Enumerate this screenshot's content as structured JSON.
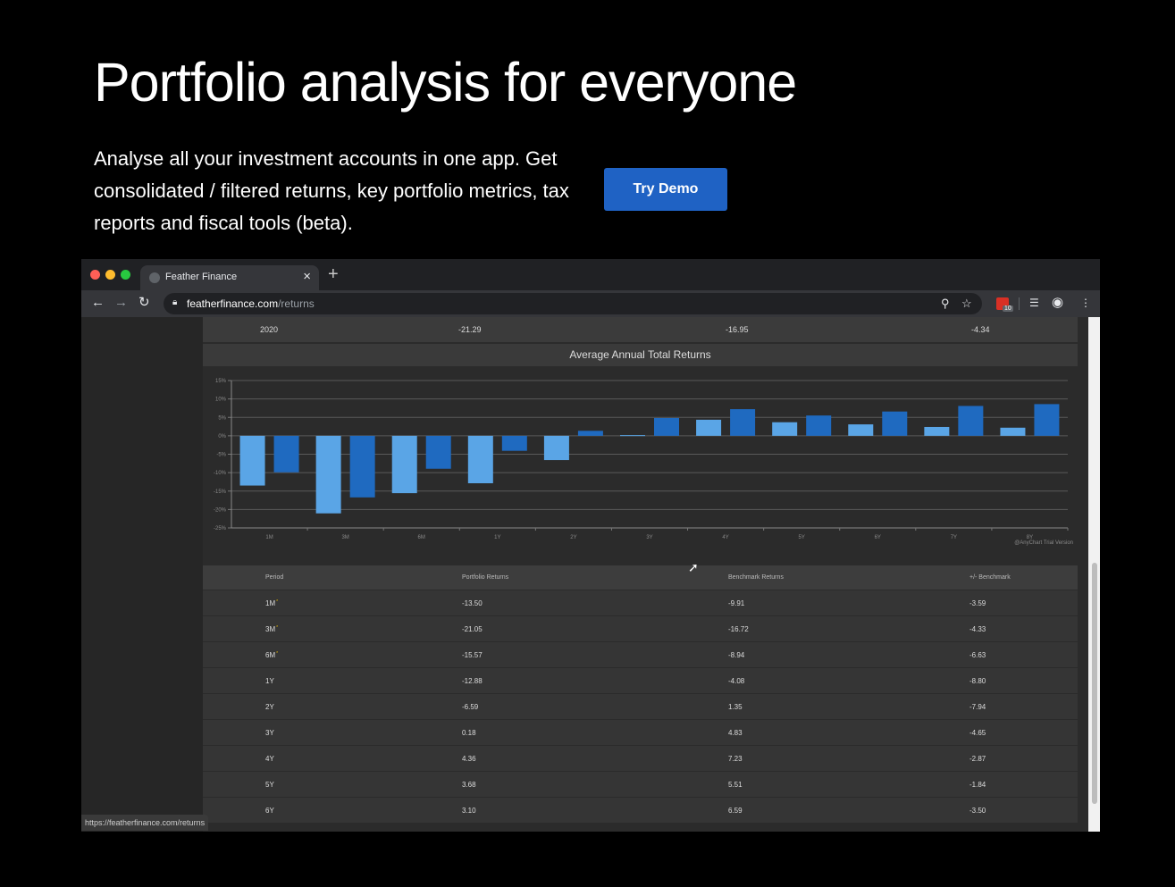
{
  "hero": {
    "title": "Portfolio analysis for everyone",
    "description": "Analyse all your investment accounts in one app. Get consolidated / filtered returns, key portfolio metrics, tax reports and fiscal tools (beta).",
    "cta_label": "Try Demo"
  },
  "browser": {
    "tab_title": "Feather Finance",
    "tab_close": "×",
    "new_tab": "+",
    "url_host": "featherfinance.com",
    "url_path": "/returns",
    "extension_badge": "10",
    "status_url": "https://featherfinance.com/returns",
    "colors": {
      "red": "#ff5f57",
      "yellow": "#febc2e",
      "green": "#28c840"
    }
  },
  "prev_row": {
    "period": "2020",
    "portfolio": "-21.29",
    "benchmark": "-16.95",
    "diff": "-4.34"
  },
  "chart_data": {
    "type": "bar",
    "title": "Average Annual Total Returns",
    "categories": [
      "1M",
      "3M",
      "6M",
      "1Y",
      "2Y",
      "3Y",
      "4Y",
      "5Y",
      "6Y",
      "7Y",
      "8Y"
    ],
    "series": [
      {
        "values": [
          -13.5,
          -21.05,
          -15.57,
          -12.88,
          -6.59,
          0.18,
          4.36,
          3.68,
          3.1,
          2.4,
          2.2
        ],
        "color": "#5aa5e6"
      },
      {
        "values": [
          -9.91,
          -16.72,
          -8.94,
          -4.08,
          1.35,
          4.83,
          7.23,
          5.51,
          6.59,
          8.1,
          8.6
        ],
        "color": "#1f6ac0"
      }
    ],
    "ylim": [
      -25,
      15
    ],
    "yticks": [
      "15%",
      "10%",
      "5%",
      "0%",
      "-5%",
      "-10%",
      "-15%",
      "-20%",
      "-25%"
    ],
    "credit": "@AnyChart Trial Version",
    "grid": true
  },
  "table": {
    "headers": [
      "Period",
      "Portfolio Returns",
      "Benchmark Returns",
      "+/- Benchmark"
    ],
    "marker": "*",
    "rows": [
      {
        "period": "1M",
        "portfolio": "-13.50",
        "benchmark": "-9.91",
        "diff": "-3.59",
        "marked": true
      },
      {
        "period": "3M",
        "portfolio": "-21.05",
        "benchmark": "-16.72",
        "diff": "-4.33",
        "marked": true
      },
      {
        "period": "6M",
        "portfolio": "-15.57",
        "benchmark": "-8.94",
        "diff": "-6.63",
        "marked": true
      },
      {
        "period": "1Y",
        "portfolio": "-12.88",
        "benchmark": "-4.08",
        "diff": "-8.80",
        "marked": false
      },
      {
        "period": "2Y",
        "portfolio": "-6.59",
        "benchmark": "1.35",
        "diff": "-7.94",
        "marked": false
      },
      {
        "period": "3Y",
        "portfolio": "0.18",
        "benchmark": "4.83",
        "diff": "-4.65",
        "marked": false
      },
      {
        "period": "4Y",
        "portfolio": "4.36",
        "benchmark": "7.23",
        "diff": "-2.87",
        "marked": false
      },
      {
        "period": "5Y",
        "portfolio": "3.68",
        "benchmark": "5.51",
        "diff": "-1.84",
        "marked": false
      },
      {
        "period": "6Y",
        "portfolio": "3.10",
        "benchmark": "6.59",
        "diff": "-3.50",
        "marked": false
      }
    ]
  }
}
